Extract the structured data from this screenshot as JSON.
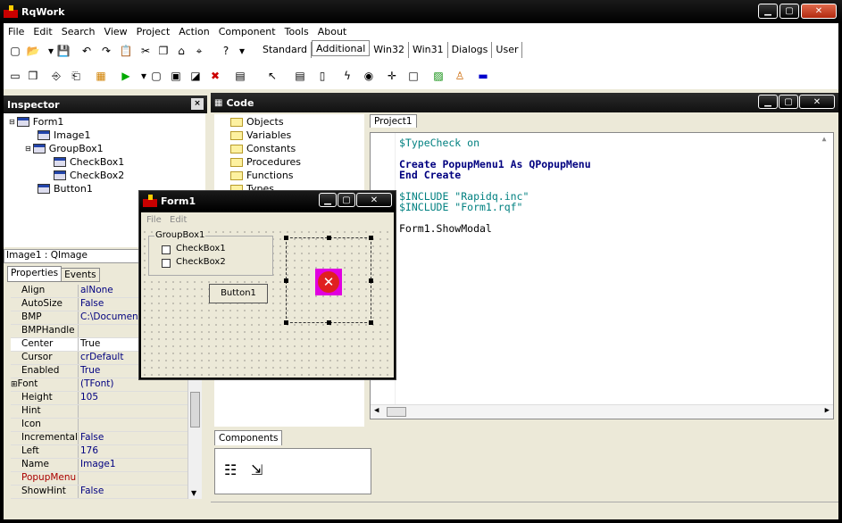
{
  "app": {
    "title": "RqWork"
  },
  "menu": [
    "File",
    "Edit",
    "Search",
    "View",
    "Project",
    "Action",
    "Component",
    "Tools",
    "About"
  ],
  "palette_tabs": [
    "Standard",
    "Additional",
    "Win32",
    "Win31",
    "Dialogs",
    "User"
  ],
  "palette_active": "Additional",
  "inspector": {
    "title": "Inspector",
    "tree": [
      "Form1",
      "Image1",
      "GroupBox1",
      "CheckBox1",
      "CheckBox2",
      "Button1"
    ],
    "selected_object": "Image1 : QImage",
    "tabs": [
      "Properties",
      "Events"
    ],
    "props": [
      {
        "k": "Align",
        "v": "alNone"
      },
      {
        "k": "AutoSize",
        "v": "False"
      },
      {
        "k": "BMP",
        "v": "C:\\Documents"
      },
      {
        "k": "BMPHandle",
        "v": ""
      },
      {
        "k": "Center",
        "v": "True"
      },
      {
        "k": "Cursor",
        "v": "crDefault"
      },
      {
        "k": "Enabled",
        "v": "True"
      },
      {
        "k": "Font",
        "v": "(TFont)"
      },
      {
        "k": "Height",
        "v": "105"
      },
      {
        "k": "Hint",
        "v": ""
      },
      {
        "k": "Icon",
        "v": ""
      },
      {
        "k": "IncrementalDis",
        "v": "False"
      },
      {
        "k": "Left",
        "v": "176"
      },
      {
        "k": "Name",
        "v": "Image1"
      },
      {
        "k": "PopupMenu",
        "v": ""
      },
      {
        "k": "ShowHint",
        "v": "False"
      }
    ]
  },
  "code": {
    "title": "Code",
    "tree": [
      "Objects",
      "Variables",
      "Constants",
      "Procedures",
      "Functions",
      "Types"
    ],
    "tab": "Project1",
    "lines": [
      {
        "t": "$TypeCheck on",
        "c": "cc"
      },
      {
        "t": "",
        "c": ""
      },
      {
        "t": "Create PopupMenu1 As QPopupMenu",
        "c": "kw"
      },
      {
        "t": "End Create",
        "c": "kw"
      },
      {
        "t": "",
        "c": ""
      },
      {
        "t": "$INCLUDE \"Rapidq.inc\"",
        "c": "cc"
      },
      {
        "t": "$INCLUDE \"Form1.rqf\"",
        "c": "cc"
      },
      {
        "t": "",
        "c": ""
      },
      {
        "t": "Form1.ShowModal",
        "c": ""
      }
    ],
    "components_tab": "Components"
  },
  "form1": {
    "title": "Form1",
    "menu": [
      "File",
      "Edit"
    ],
    "groupbox": "GroupBox1",
    "checkboxes": [
      "CheckBox1",
      "CheckBox2"
    ],
    "button": "Button1"
  }
}
